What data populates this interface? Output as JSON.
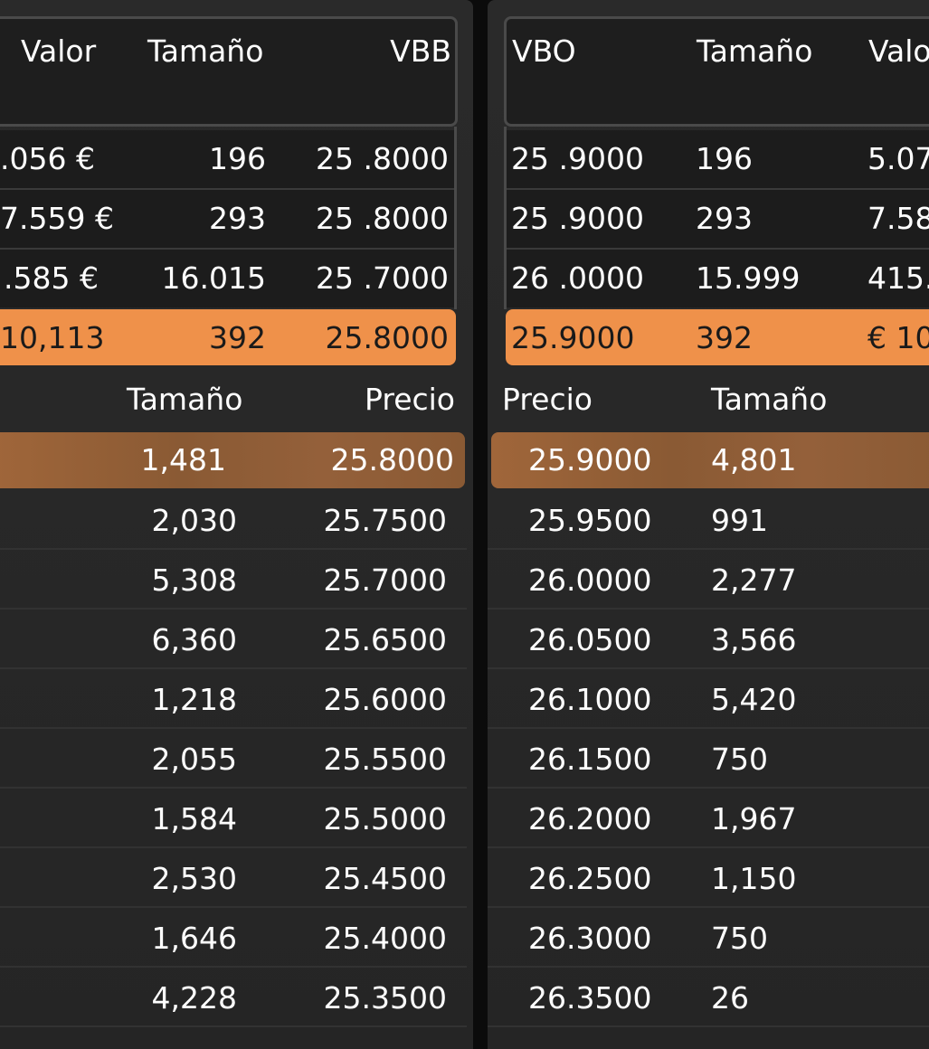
{
  "left": {
    "header": {
      "valor": "Valor",
      "tamano": "Tamaño",
      "vbb": "VBB"
    },
    "rows": [
      {
        "valor": ".056 €",
        "tamano": "196",
        "vbb": "25 .8000"
      },
      {
        "valor": "7.559 €",
        "tamano": "293",
        "vbb": "25 .8000"
      },
      {
        "valor": ".585 €",
        "tamano": "16.015",
        "vbb": "25 .7000"
      }
    ],
    "highlight": {
      "valor": "10,113",
      "tamano": "392",
      "vbb": "25.8000"
    },
    "book_header": {
      "tamano": "Tamaño",
      "precio": "Precio"
    },
    "book_highlight": {
      "tamano": "1,481",
      "precio": "25.8000"
    },
    "book": [
      {
        "tamano": "2,030",
        "precio": "25.7500"
      },
      {
        "tamano": "5,308",
        "precio": "25.7000"
      },
      {
        "tamano": "6,360",
        "precio": "25.6500"
      },
      {
        "tamano": "1,218",
        "precio": "25.6000"
      },
      {
        "tamano": "2,055",
        "precio": "25.5500"
      },
      {
        "tamano": "1,584",
        "precio": "25.5000"
      },
      {
        "tamano": "2,530",
        "precio": "25.4500"
      },
      {
        "tamano": "1,646",
        "precio": "25.4000"
      },
      {
        "tamano": "4,228",
        "precio": "25.3500"
      }
    ]
  },
  "right": {
    "header": {
      "vbo": "VBO",
      "tamano": "Tamaño",
      "valor": "Valo"
    },
    "rows": [
      {
        "vbo": "25 .9000",
        "tamano": "196",
        "valor": "5.07"
      },
      {
        "vbo": "25 .9000",
        "tamano": "293",
        "valor": "7.58"
      },
      {
        "vbo": "26 .0000",
        "tamano": "15.999",
        "valor": "415."
      }
    ],
    "highlight": {
      "vbo": "25.9000",
      "tamano": "392",
      "valor": "€ 10"
    },
    "book_header": {
      "precio": "Precio",
      "tamano": "Tamaño"
    },
    "book_highlight": {
      "precio": "25.9000",
      "tamano": "4,801"
    },
    "book": [
      {
        "precio": "25.9500",
        "tamano": "991"
      },
      {
        "precio": "26.0000",
        "tamano": "2,277"
      },
      {
        "precio": "26.0500",
        "tamano": "3,566"
      },
      {
        "precio": "26.1000",
        "tamano": "5,420"
      },
      {
        "precio": "26.1500",
        "tamano": "750"
      },
      {
        "precio": "26.2000",
        "tamano": "1,967"
      },
      {
        "precio": "26.2500",
        "tamano": "1,150"
      },
      {
        "precio": "26.3000",
        "tamano": "750"
      },
      {
        "precio": "26.3500",
        "tamano": "26"
      }
    ]
  },
  "colors": {
    "accent": "#ef914a",
    "background": "#262626",
    "text": "#ffffff"
  }
}
